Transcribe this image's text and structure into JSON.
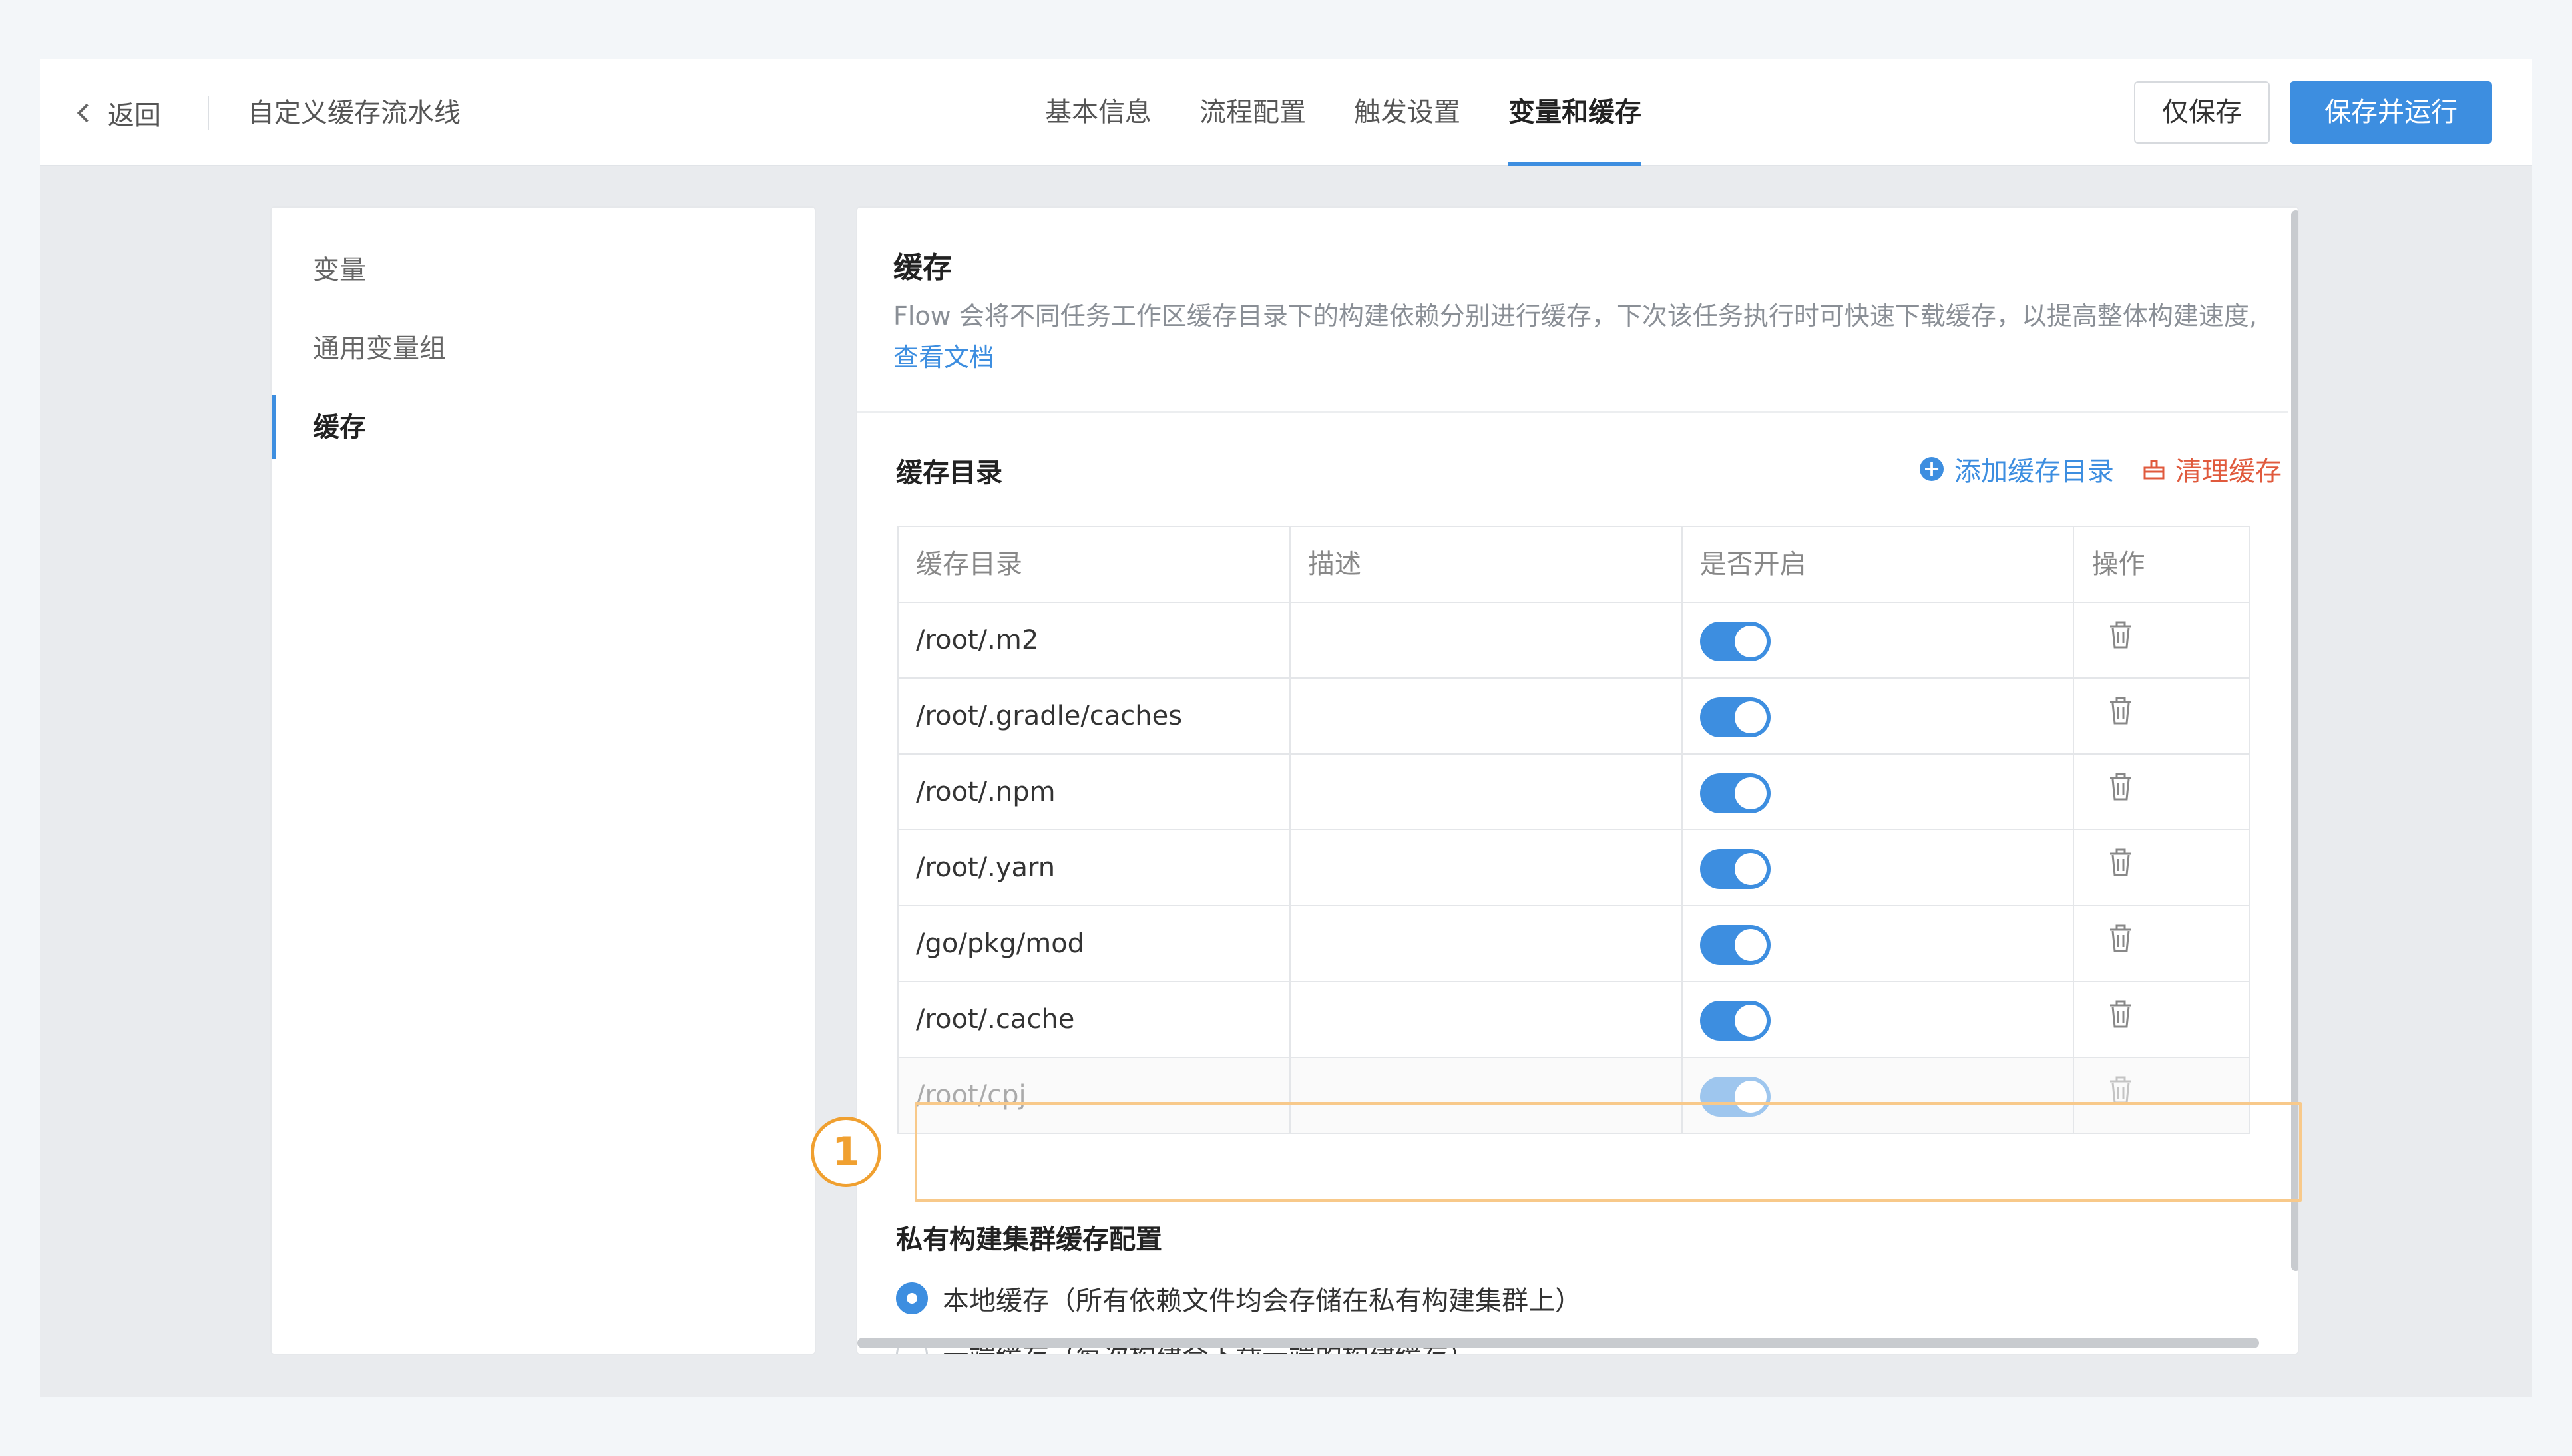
{
  "header": {
    "back_label": "返回",
    "pipeline_name": "自定义缓存流水线",
    "tabs": [
      {
        "label": "基本信息",
        "active": false
      },
      {
        "label": "流程配置",
        "active": false
      },
      {
        "label": "触发设置",
        "active": false
      },
      {
        "label": "变量和缓存",
        "active": true
      }
    ],
    "save_only_label": "仅保存",
    "save_run_label": "保存并运行"
  },
  "sidebar": {
    "items": [
      {
        "label": "变量",
        "active": false
      },
      {
        "label": "通用变量组",
        "active": false
      },
      {
        "label": "缓存",
        "active": true
      }
    ]
  },
  "cache": {
    "title": "缓存",
    "description": "Flow 会将不同任务工作区缓存目录下的构建依赖分别进行缓存，下次该任务执行时可快速下载缓存，以提高整体构建速度,",
    "doc_link": "查看文档",
    "dir_section_title": "缓存目录",
    "add_label": "添加缓存目录",
    "clear_label": "清理缓存",
    "table": {
      "columns": [
        "缓存目录",
        "描述",
        "是否开启",
        "操作"
      ],
      "rows": [
        {
          "path": "/root/.m2",
          "desc": "",
          "enabled": true,
          "faded": false
        },
        {
          "path": "/root/.gradle/caches",
          "desc": "",
          "enabled": true,
          "faded": false
        },
        {
          "path": "/root/.npm",
          "desc": "",
          "enabled": true,
          "faded": false
        },
        {
          "path": "/root/.yarn",
          "desc": "",
          "enabled": true,
          "faded": false
        },
        {
          "path": "/go/pkg/mod",
          "desc": "",
          "enabled": true,
          "faded": false
        },
        {
          "path": "/root/.cache",
          "desc": "",
          "enabled": true,
          "faded": false
        },
        {
          "path": "/root/cpj",
          "desc": "",
          "enabled": true,
          "faded": true
        }
      ]
    },
    "annotation_number": "1",
    "private_section_title": "私有构建集群缓存配置",
    "options": [
      {
        "label": "本地缓存（所有依赖文件均会存储在私有构建集群上）",
        "checked": true
      },
      {
        "label": "云端缓存（每次构建会下载云端的构建缓存）",
        "checked": false
      }
    ]
  },
  "colors": {
    "accent": "#3d8ee0",
    "danger": "#e05a3d",
    "highlight": "#f8c98a",
    "marker": "#f0a030"
  }
}
